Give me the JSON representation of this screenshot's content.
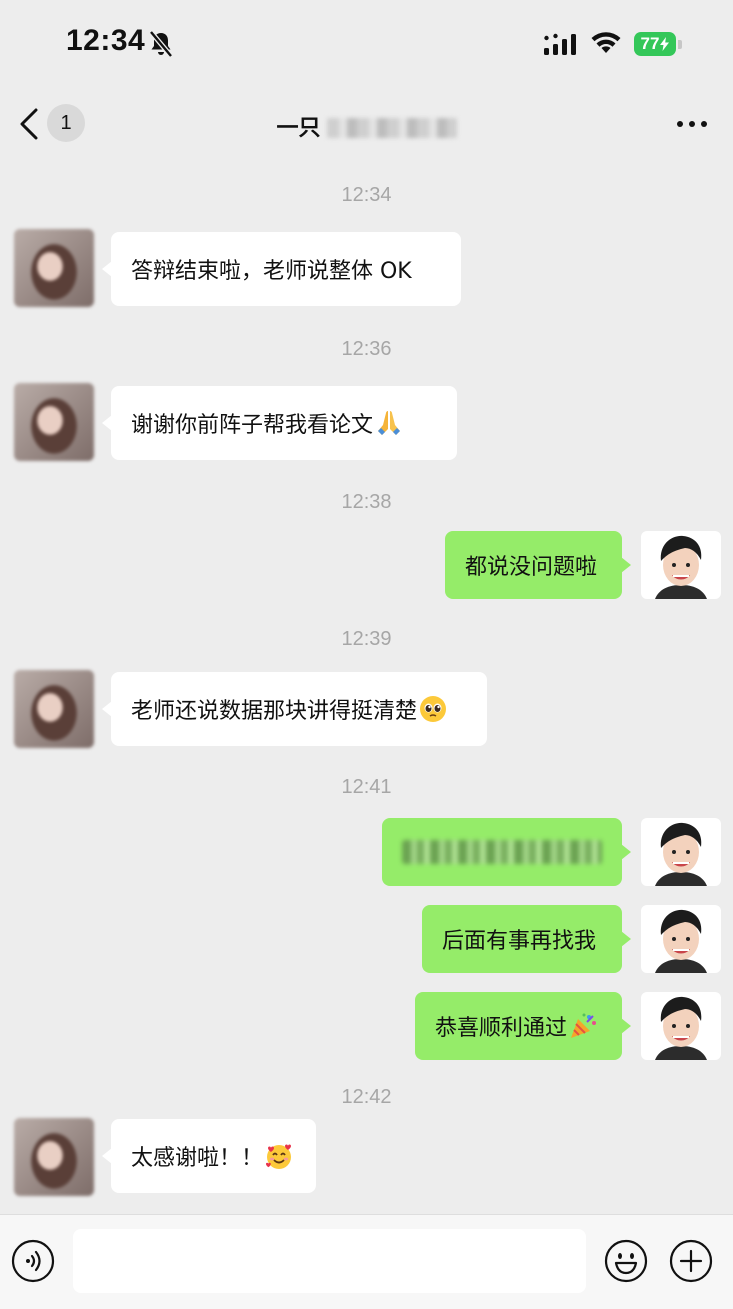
{
  "status_bar": {
    "time": "12:34",
    "battery": "77"
  },
  "header": {
    "back_count": "1",
    "title": "一只"
  },
  "messages": [
    {
      "time": "12:34",
      "side": "in",
      "text": "答辩结束啦，老师说整体 OK"
    },
    {
      "time": "12:36",
      "side": "in",
      "text": "谢谢你前阵子帮我看论文",
      "emoji": "folded-hands-emoji"
    },
    {
      "time": "12:38",
      "side": "out",
      "text": "都说没问题啦"
    },
    {
      "time": "12:39",
      "side": "in",
      "text": "老师还说数据那块讲得挺清楚",
      "emoji": "pleading-face-emoji"
    },
    {
      "time": "12:41",
      "side": "out",
      "text": "",
      "blurred": true
    },
    {
      "side": "out",
      "text": "后面有事再找我"
    },
    {
      "side": "out",
      "text": "恭喜顺利通过",
      "emoji": "party-popper-emoji"
    },
    {
      "time": "12:42",
      "side": "in",
      "text": "太感谢啦！！",
      "emoji": "smiling-face-with-hearts-emoji"
    }
  ],
  "colors": {
    "background": "#ededed",
    "outgoing_bubble": "#95ec69",
    "incoming_bubble": "#ffffff",
    "battery": "#34c759"
  },
  "input": {
    "value": "",
    "placeholder": ""
  }
}
